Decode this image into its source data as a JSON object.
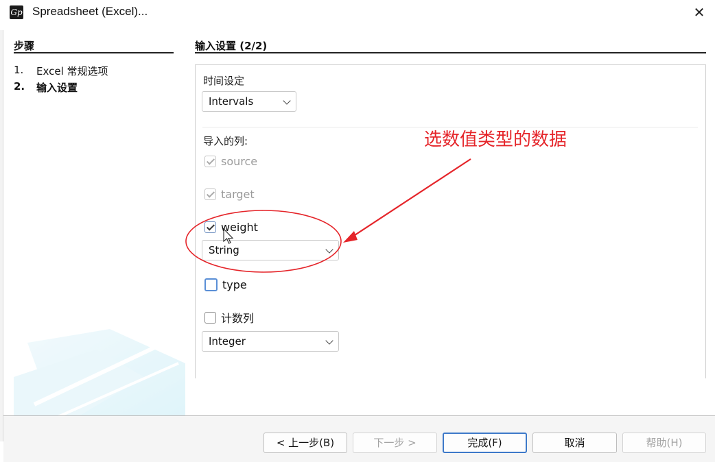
{
  "window": {
    "title": "Spreadsheet (Excel)...",
    "close_symbol": "✕"
  },
  "steps": {
    "header": "步骤",
    "items": [
      {
        "num": "1.",
        "label": "Excel 常规选项",
        "active": false
      },
      {
        "num": "2.",
        "label": "输入设置",
        "active": true
      }
    ]
  },
  "content": {
    "header": "输入设置 (2/2)",
    "time_label": "时间设定",
    "time_value": "Intervals",
    "columns_label": "导入的列:",
    "columns": [
      {
        "name": "source",
        "checked": true,
        "enabled": false
      },
      {
        "name": "target",
        "checked": true,
        "enabled": false
      },
      {
        "name": "weight",
        "checked": true,
        "enabled": true,
        "type_value": "String"
      },
      {
        "name": "type",
        "checked": false,
        "enabled": true
      },
      {
        "name": "计数列",
        "checked": false,
        "enabled": true,
        "type_value": "Integer"
      }
    ]
  },
  "annotation": {
    "text": "选数值类型的数据",
    "color": "#e5252a"
  },
  "footer": {
    "back": "< 上一步(B)",
    "next": "下一步 >",
    "finish": "完成(F)",
    "cancel": "取消",
    "help": "帮助(H)"
  }
}
